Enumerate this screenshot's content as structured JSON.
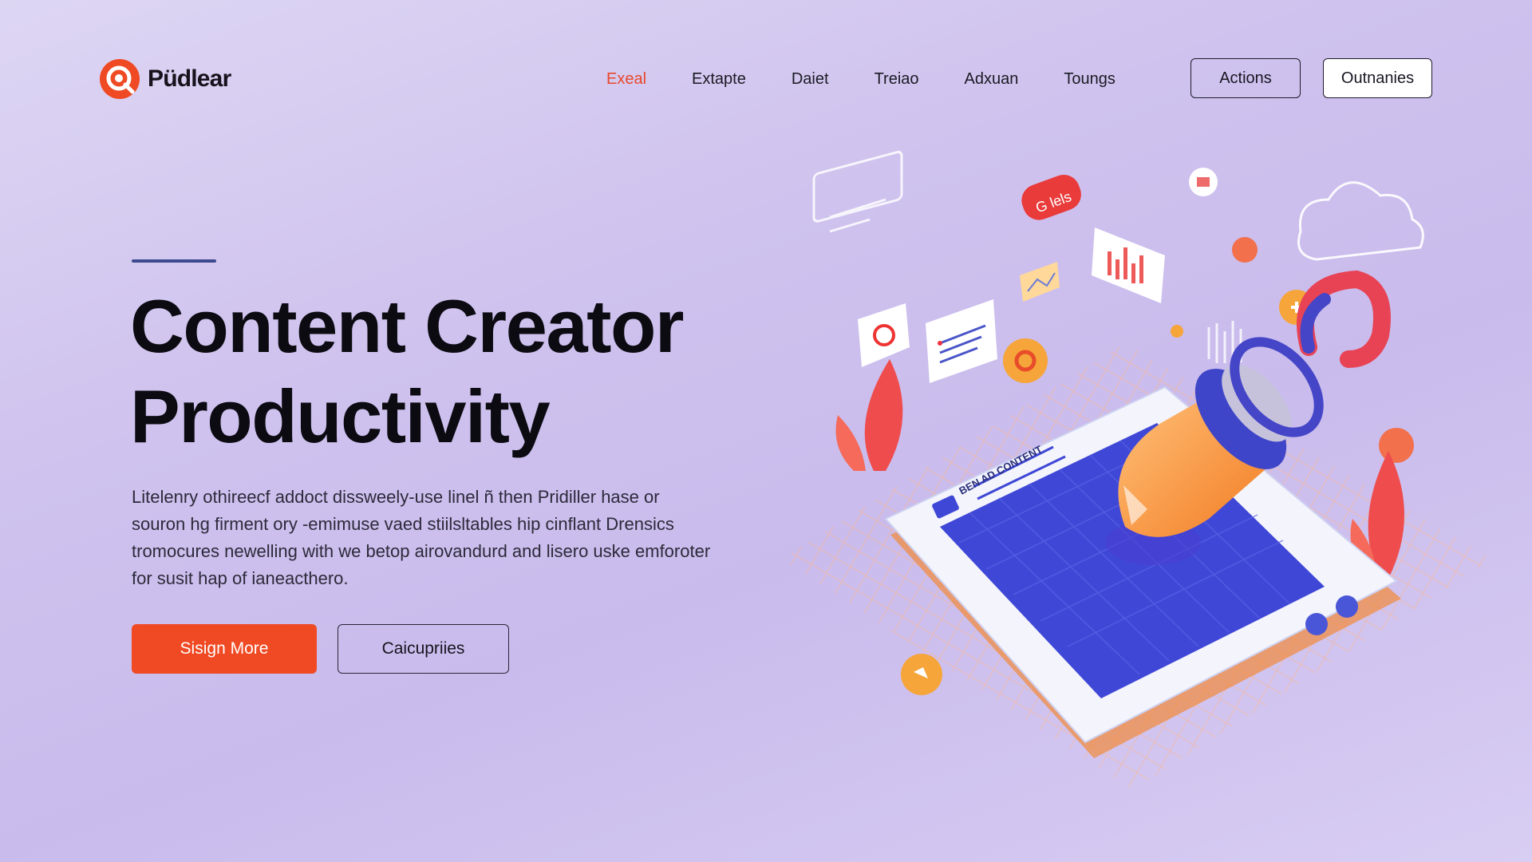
{
  "brand": {
    "name": "Püdlear"
  },
  "nav": {
    "items": [
      {
        "label": "Exeal",
        "active": true
      },
      {
        "label": "Extapte",
        "active": false
      },
      {
        "label": "Daiet",
        "active": false
      },
      {
        "label": "Treiao",
        "active": false
      },
      {
        "label": "Adxuan",
        "active": false
      },
      {
        "label": "Toungs",
        "active": false
      }
    ],
    "actions_label": "Actions",
    "outnanies_label": "Outnanies"
  },
  "hero": {
    "title_line1": "Content Creator",
    "title_line2": "Productivity",
    "description_lines": [
      "Litelenry othireecf addoct dissweely-use linel ñ then Pridiller hase or",
      "souron hg firment ory -emimuse vaed stiilsltables hip cinflant Drensics",
      "tromocures newelling with we betop airovandurd and lisero uske emforoter",
      "for susit hap of ianeacthero."
    ],
    "primary_button": "Sisign More",
    "secondary_button": "Caicupriies"
  },
  "illustration": {
    "screen_label": "BEN AD CONTENT",
    "bubble_label": "G lels"
  },
  "colors": {
    "accent": "#ef4a23",
    "accent_text": "#e8482a",
    "grid_blue": "#3f47d6",
    "orange": "#f59b3a",
    "rule": "#3e4a8e"
  }
}
